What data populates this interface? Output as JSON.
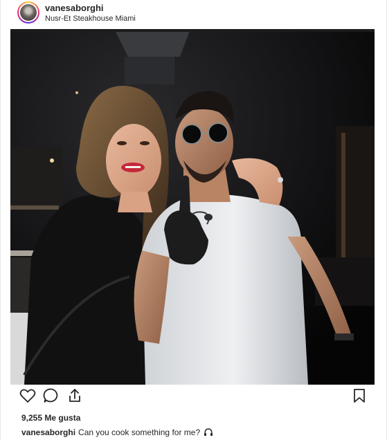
{
  "header": {
    "username": "vanesaborghi",
    "location": "Nusr-Et Steakhouse Miami"
  },
  "actions": {
    "like_icon": "heart-icon",
    "comment_icon": "comment-icon",
    "share_icon": "share-icon",
    "save_icon": "bookmark-icon"
  },
  "likes": "9,255 Me gusta",
  "caption": {
    "username": "vanesaborghi",
    "text": "Can you cook something for me?",
    "emoji": "🎧"
  },
  "colors": {
    "text": "#262626",
    "border": "#e6e6e6",
    "photo_bg": "#0b0b0c"
  }
}
